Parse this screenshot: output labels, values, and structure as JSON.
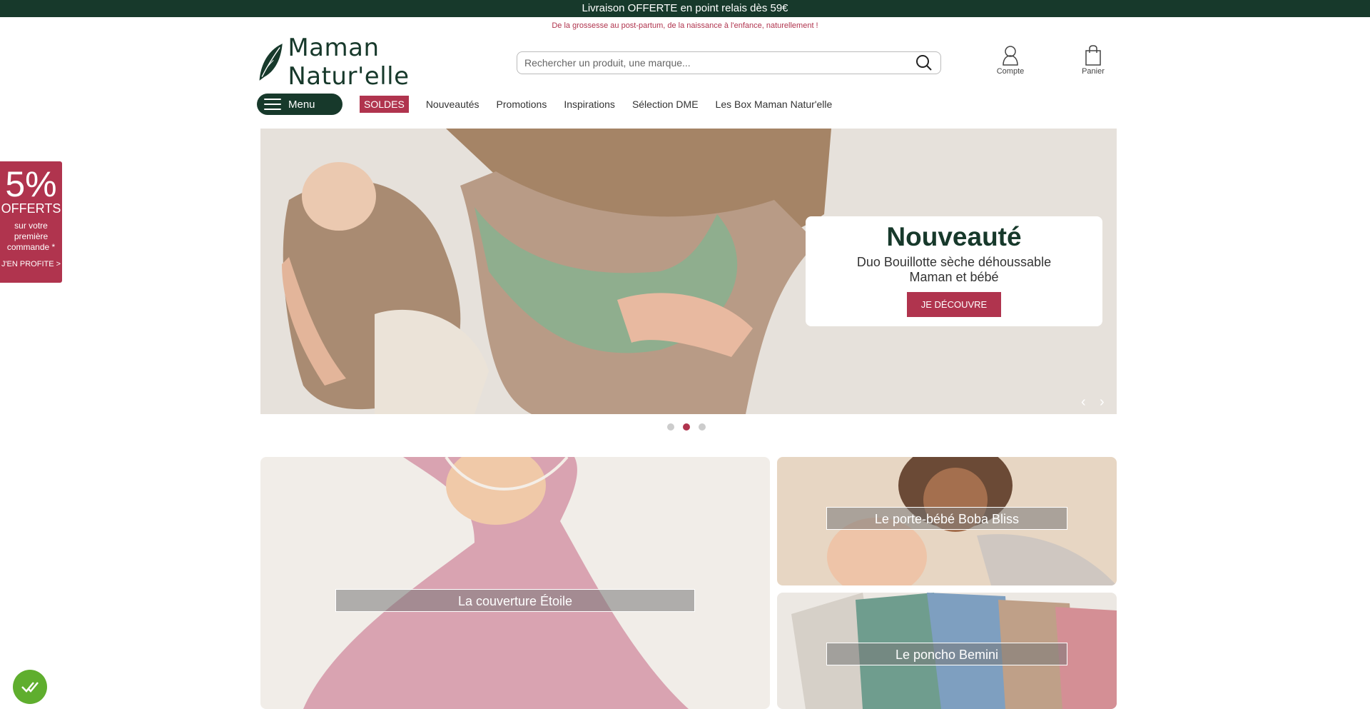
{
  "topbar": {
    "text": "Livraison OFFERTE en point relais dès 59€"
  },
  "tagline": "De la grossesse au post-partum, de la naissance à l'enfance, naturellement !",
  "brand": {
    "name": "Maman Natur'elle",
    "color_primary": "#17392b",
    "color_accent": "#b0344e"
  },
  "search": {
    "placeholder": "Rechercher un produit, une marque...",
    "icon": "search-icon"
  },
  "account": {
    "label": "Compte",
    "icon": "user-icon"
  },
  "cart": {
    "label": "Panier",
    "icon": "bag-icon"
  },
  "nav": {
    "menu_label": "Menu",
    "soldes": "SOLDES",
    "items": [
      "Nouveautés",
      "Promotions",
      "Inspirations",
      "Sélection DME",
      "Les Box Maman Natur'elle"
    ]
  },
  "hero": {
    "title": "Nouveauté",
    "subtitle_line1": "Duo Bouillotte sèche déhoussable",
    "subtitle_line2": "Maman et bébé",
    "button": "JE DÉCOUVRE",
    "slides_total": 3,
    "active_slide": 2
  },
  "tiles": [
    {
      "label": "La couverture Étoile"
    },
    {
      "label": "Le porte-bébé Boba Bliss"
    },
    {
      "label": "Le poncho Bemini"
    }
  ],
  "promo_side": {
    "percent": "5%",
    "offerts": "OFFERTS",
    "desc_1": "sur votre",
    "desc_2": "première",
    "desc_3": "commande *",
    "cta": "J'EN PROFITE >"
  },
  "cookie": {
    "icon": "cookie-consent-icon"
  }
}
